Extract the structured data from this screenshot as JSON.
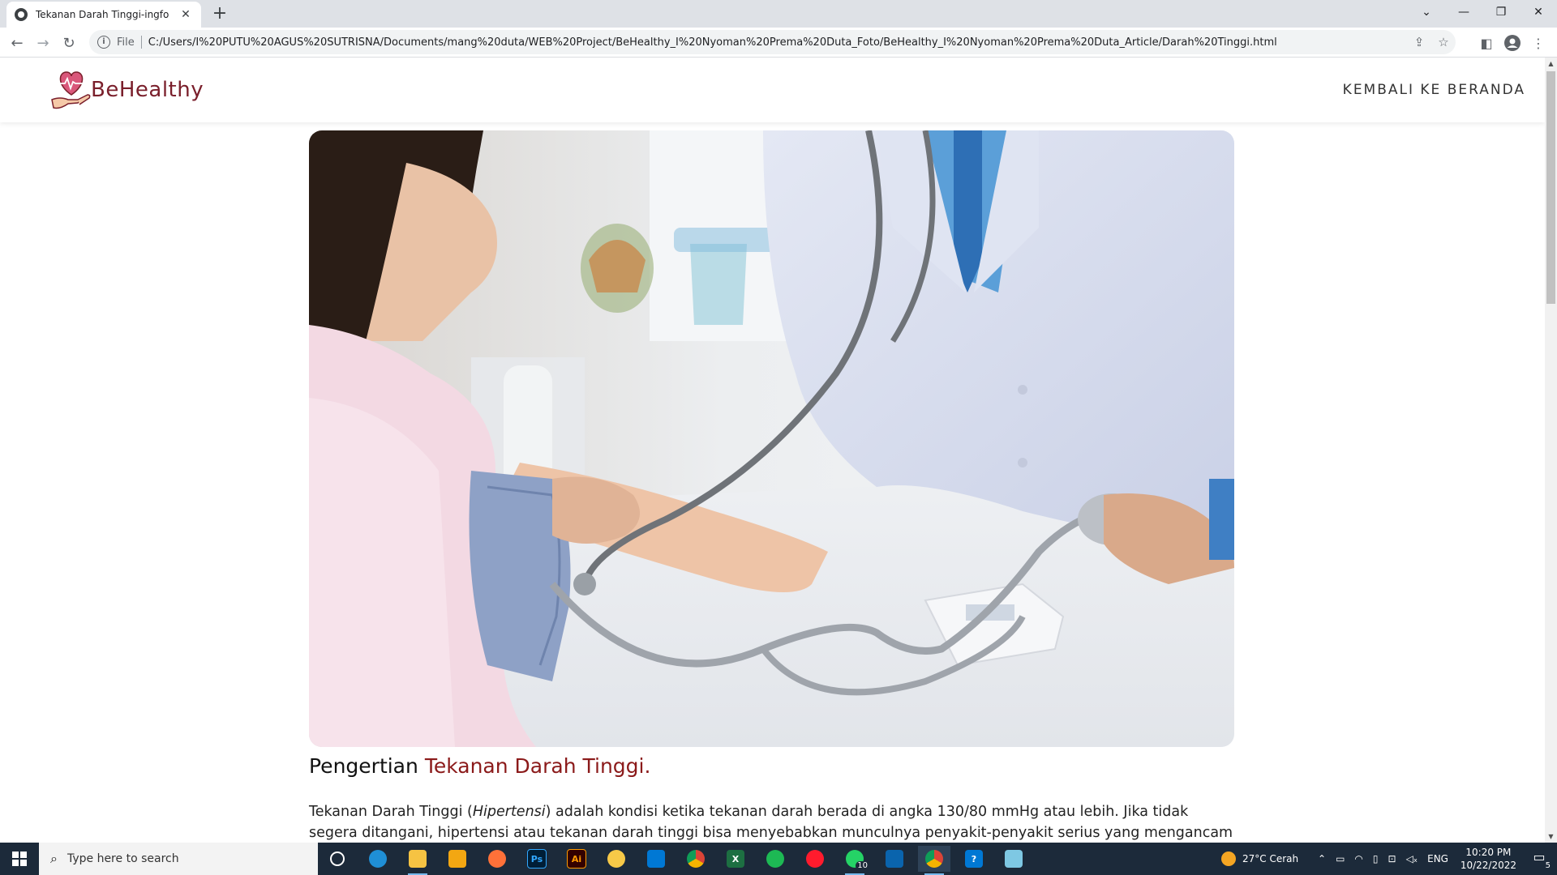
{
  "browser": {
    "tab_title": "Tekanan Darah Tinggi-ingfo",
    "scheme_label": "File",
    "url": "C:/Users/I%20PUTU%20AGUS%20SUTRISNA/Documents/mang%20duta/WEB%20Project/BeHealthy_I%20Nyoman%20Prema%20Duta_Foto/BeHealthy_I%20Nyoman%20Prema%20Duta_Article/Darah%20Tinggi.html"
  },
  "site": {
    "logo_text": "BeHealthy",
    "nav_link": "KEMBALI KE BERANDA"
  },
  "article": {
    "title_prefix": "Pengertian ",
    "title_accent": "Tekanan Darah Tinggi.",
    "body_p1_before": "Tekanan Darah Tinggi (",
    "body_p1_italic": "Hipertensi",
    "body_p1_after": ") adalah kondisi ketika tekanan darah berada di angka 130/80 mmHg atau lebih. Jika tidak segera ditangani, hipertensi atau tekanan darah tinggi bisa menyebabkan munculnya penyakit-penyakit serius yang mengancam nyawa, seperti gagal"
  },
  "taskbar": {
    "search_placeholder": "Type here to search",
    "weather": "27°C  Cerah",
    "language": "ENG",
    "time": "10:20 PM",
    "date": "10/22/2022",
    "whatsapp_badge": "10",
    "notification_count": "5"
  },
  "colors": {
    "brand": "#7a1f2b",
    "accent_title": "#8b1a1a",
    "taskbar": "#1c2a3a"
  }
}
